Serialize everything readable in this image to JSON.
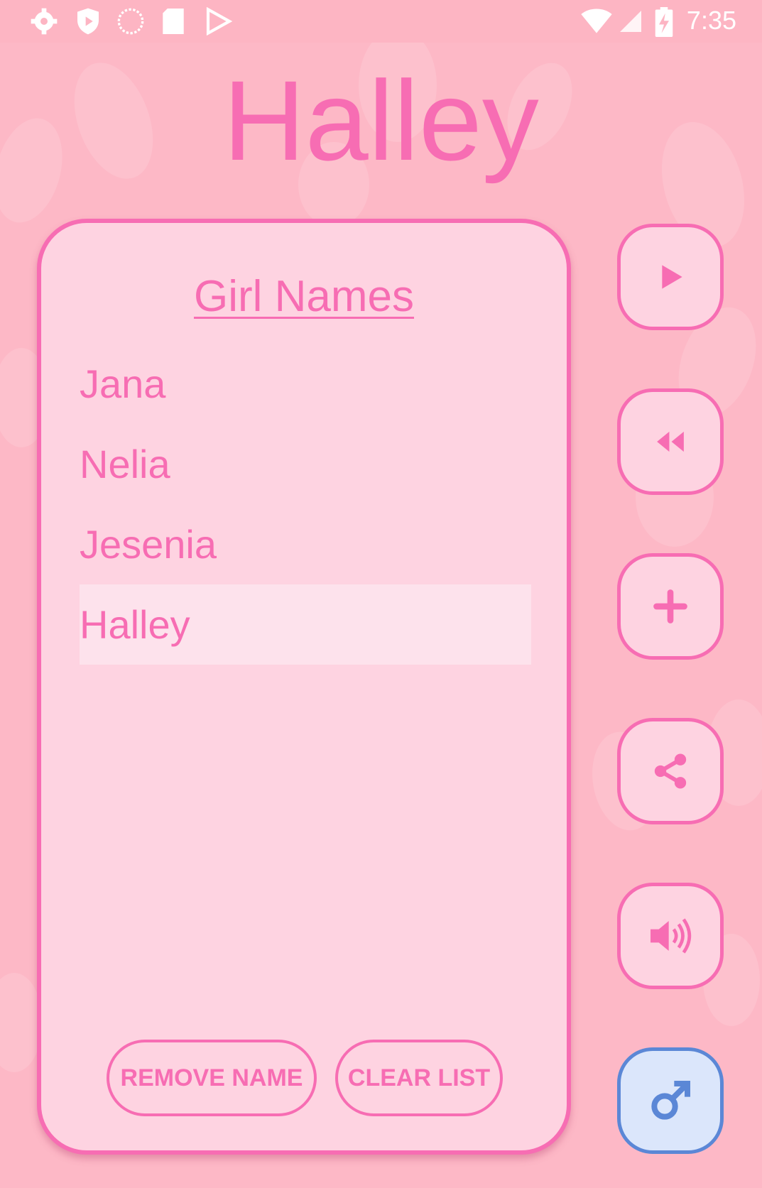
{
  "status_bar": {
    "time": "7:35",
    "left_icons": [
      "settings-icon",
      "shield-play-icon",
      "sync-circle-icon",
      "sd-card-icon",
      "play-store-icon"
    ],
    "right_icons": [
      "wifi-icon",
      "cell-signal-icon",
      "battery-charging-icon"
    ]
  },
  "header": {
    "selected_name": "Halley"
  },
  "list_card": {
    "title": "Girl Names",
    "names": [
      "Jana",
      "Nelia",
      "Jesenia",
      "Halley"
    ],
    "selected_index": 3,
    "remove_label": "REMOVE NAME",
    "clear_label": "CLEAR LIST"
  },
  "side_buttons": [
    {
      "icon": "play-icon"
    },
    {
      "icon": "rewind-icon"
    },
    {
      "icon": "plus-icon"
    },
    {
      "icon": "share-icon"
    },
    {
      "icon": "volume-icon"
    },
    {
      "icon": "male-symbol-icon"
    }
  ],
  "colors": {
    "accent": "#f76db3",
    "background": "#fdb8c6",
    "card": "#fed3e1",
    "selected_row": "#fde2ec",
    "gender_button_border": "#5b87d6",
    "gender_button_fill": "#dbe6fb"
  }
}
